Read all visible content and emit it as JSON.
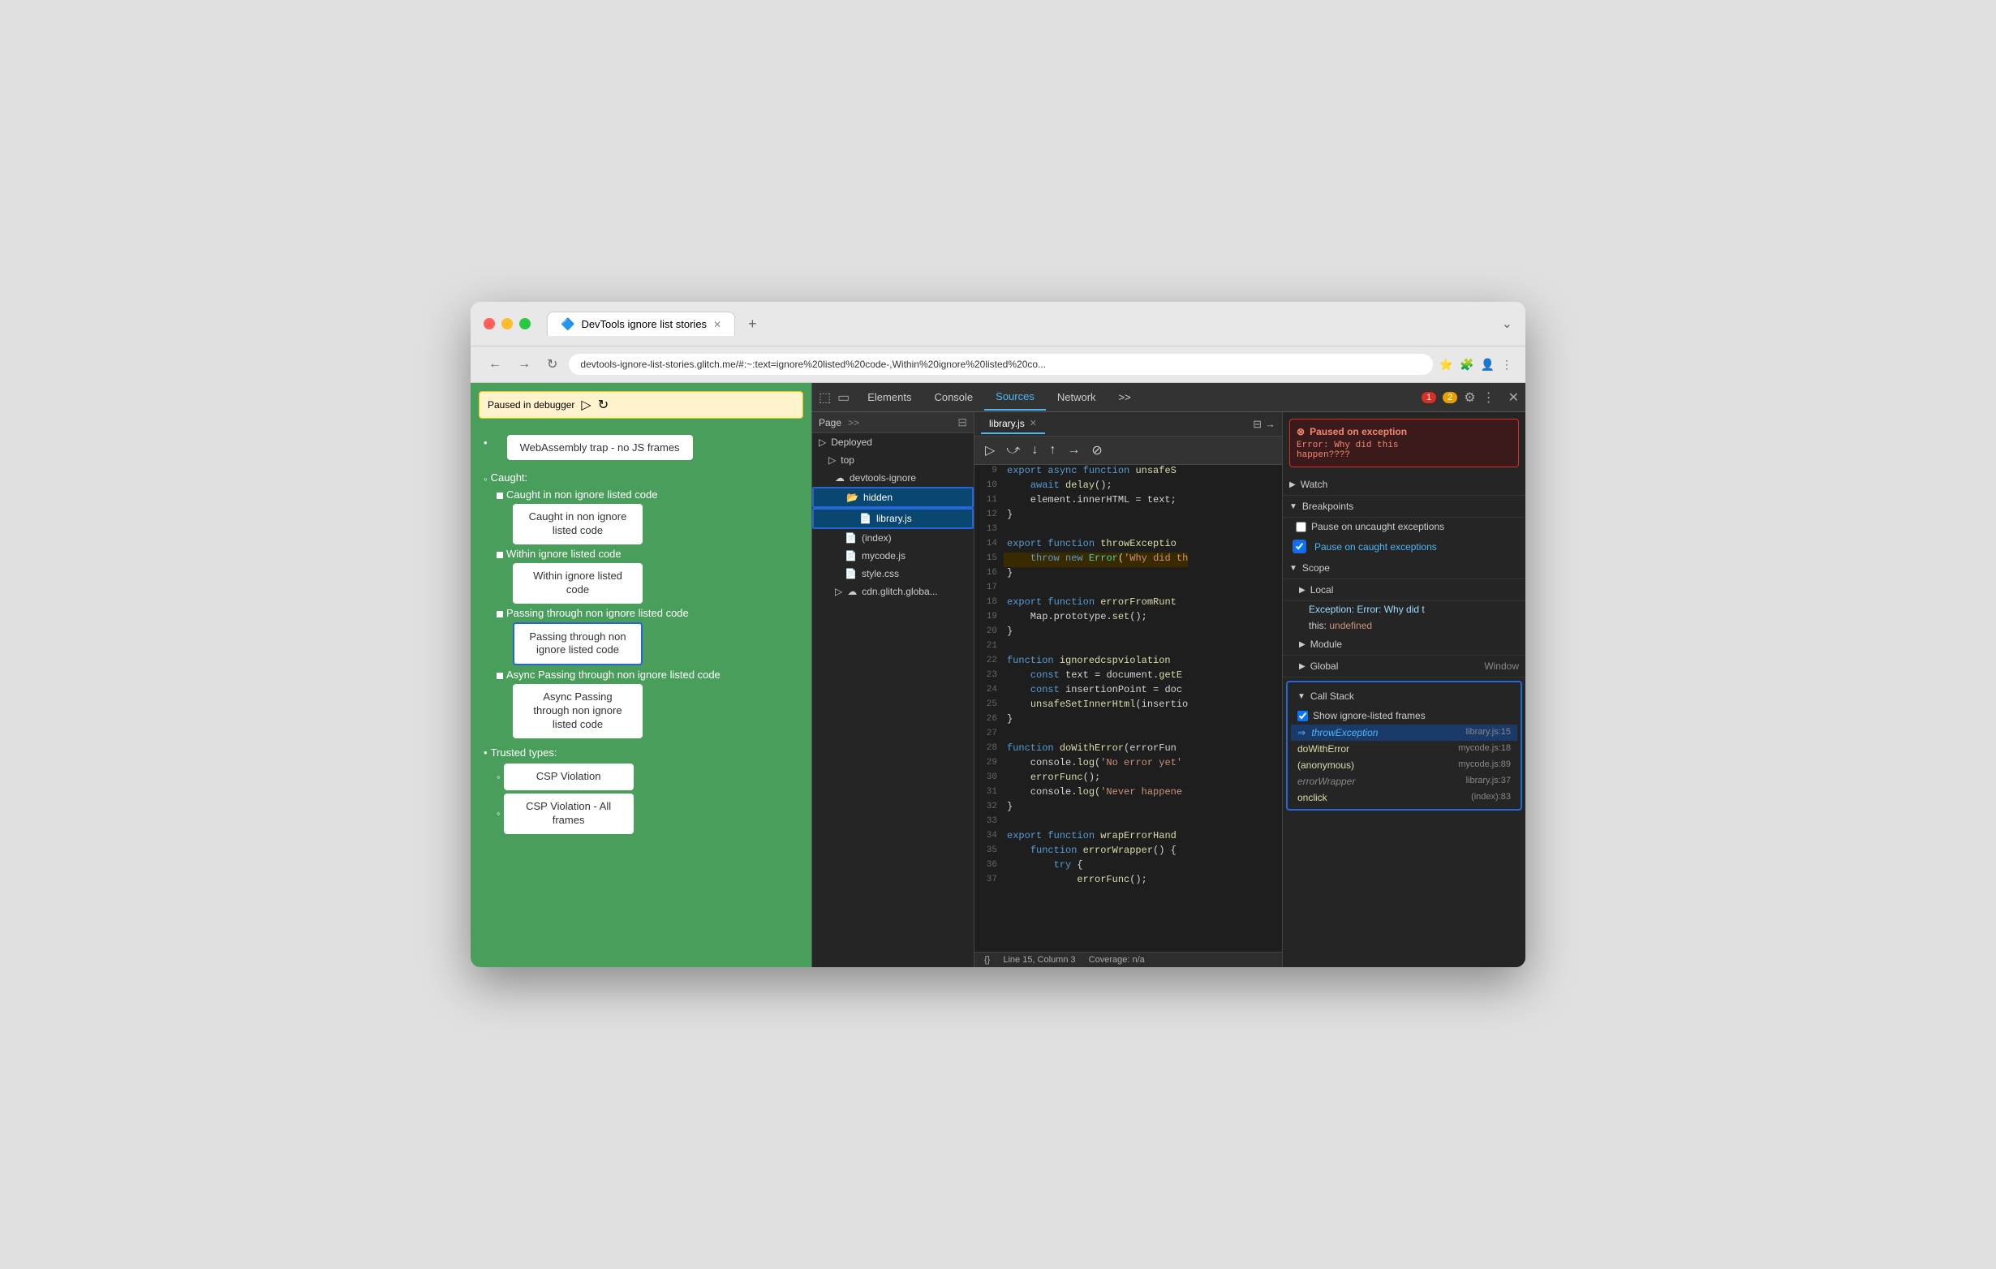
{
  "browser": {
    "tab_title": "DevTools ignore list stories",
    "tab_icon": "🔷",
    "address": "devtools-ignore-list-stories.glitch.me/#:~:text=ignore%20listed%20code-,Within%20ignore%20listed%20co...",
    "new_tab_label": "+",
    "tab_overflow_label": "⌄"
  },
  "nav": {
    "back_label": "←",
    "forward_label": "→",
    "refresh_label": "↻"
  },
  "webpage": {
    "debugger_bar": "Paused in debugger",
    "webassembly_item": "WebAssembly trap - no JS frames",
    "caught_section": "Caught:",
    "caught_items": [
      {
        "label": "Caught in non ignore listed code"
      },
      {
        "label": "Within ignore listed code"
      },
      {
        "label": "Passing through non ignore listed code"
      },
      {
        "label": "Async Passing through non ignore listed code"
      }
    ],
    "caught_btns": [
      {
        "label": "Caught in non ignore listed code",
        "active": false
      },
      {
        "label": "Within ignore listed code",
        "active": false
      },
      {
        "label": "Passing through non ignore listed code",
        "active": true
      },
      {
        "label": "Async Passing through non ignore listed code",
        "active": false
      }
    ],
    "trusted_section": "Trusted types:",
    "trusted_items": [
      {
        "label": "CSP Violation"
      },
      {
        "label": "CSP Violation - All frames"
      }
    ]
  },
  "devtools": {
    "tabs": [
      "Elements",
      "Console",
      "Sources",
      "Network",
      ">>"
    ],
    "active_tab": "Sources",
    "error_count": "1",
    "warn_count": "2",
    "file_tab_label": "library.js",
    "page_label": "Page",
    "tree": {
      "deployed_label": "Deployed",
      "top_label": "top",
      "devtools_ignore_label": "devtools-ignore",
      "hidden_label": "hidden",
      "library_label": "library.js",
      "index_label": "(index)",
      "mycode_label": "mycode.js",
      "style_label": "style.css",
      "cdn_label": "cdn.glitch.globa..."
    },
    "code_lines": [
      {
        "num": "9",
        "content": "export async function unsafeS",
        "highlight": false
      },
      {
        "num": "10",
        "content": "    await delay();",
        "highlight": false
      },
      {
        "num": "11",
        "content": "    element.innerHTML = text;",
        "highlight": false
      },
      {
        "num": "12",
        "content": "}",
        "highlight": false
      },
      {
        "num": "13",
        "content": "",
        "highlight": false
      },
      {
        "num": "14",
        "content": "export function throwExceptio",
        "highlight": false
      },
      {
        "num": "15",
        "content": "    throw new Error('Why did th",
        "highlight": true
      },
      {
        "num": "16",
        "content": "}",
        "highlight": false
      },
      {
        "num": "17",
        "content": "",
        "highlight": false
      },
      {
        "num": "18",
        "content": "export function errorFromRunt",
        "highlight": false
      },
      {
        "num": "19",
        "content": "    Map.prototype.set();",
        "highlight": false
      },
      {
        "num": "20",
        "content": "}",
        "highlight": false
      },
      {
        "num": "21",
        "content": "",
        "highlight": false
      },
      {
        "num": "22",
        "content": "function ignoredcspviolation",
        "highlight": false
      },
      {
        "num": "23",
        "content": "    const text = document.getE",
        "highlight": false
      },
      {
        "num": "24",
        "content": "    const insertionPoint = doc",
        "highlight": false
      },
      {
        "num": "25",
        "content": "    unsafeSetInnerHtml(insertio",
        "highlight": false
      },
      {
        "num": "26",
        "content": "}",
        "highlight": false
      },
      {
        "num": "27",
        "content": "",
        "highlight": false
      },
      {
        "num": "28",
        "content": "function doWithError(errorFun",
        "highlight": false
      },
      {
        "num": "29",
        "content": "    console.log('No error yet'",
        "highlight": false
      },
      {
        "num": "30",
        "content": "    errorFunc();",
        "highlight": false
      },
      {
        "num": "31",
        "content": "    console.log('Never happene",
        "highlight": false
      },
      {
        "num": "32",
        "content": "}",
        "highlight": false
      },
      {
        "num": "33",
        "content": "",
        "highlight": false
      },
      {
        "num": "34",
        "content": "export function wrapErrorHand",
        "highlight": false
      },
      {
        "num": "35",
        "content": "    function errorWrapper() {",
        "highlight": false
      },
      {
        "num": "36",
        "content": "        try {",
        "highlight": false
      },
      {
        "num": "37",
        "content": "            errorFunc();",
        "highlight": false
      }
    ],
    "status_bar": {
      "line_col": "Line 15, Column 3",
      "coverage": "Coverage: n/a"
    },
    "debugger": {
      "exception_title": "⊗ Paused on exception",
      "exception_msg": "Error: Why did this\nhappen????",
      "watch_label": "Watch",
      "breakpoints_label": "Breakpoints",
      "pause_uncaught_label": "Pause on uncaught exceptions",
      "pause_caught_label": "Pause on caught exceptions",
      "pause_caught_checked": true,
      "scope_label": "Scope",
      "local_label": "Local",
      "exception_key": "Exception: Error: Why did t",
      "this_val": "this: undefined",
      "module_label": "Module",
      "global_label": "Global",
      "global_val": "Window",
      "callstack_label": "Call Stack",
      "show_frames_label": "Show ignore-listed frames",
      "show_frames_checked": true,
      "frames": [
        {
          "name": "throwException",
          "loc": "library.js:15",
          "active": true,
          "dimmed": true
        },
        {
          "name": "doWithError",
          "loc": "mycode.js:18",
          "active": false,
          "dimmed": false
        },
        {
          "name": "(anonymous)",
          "loc": "mycode.js:89",
          "active": false,
          "dimmed": false
        },
        {
          "name": "errorWrapper",
          "loc": "library.js:37",
          "active": false,
          "dimmed": true
        },
        {
          "name": "onclick",
          "loc": "(index):83",
          "active": false,
          "dimmed": false
        }
      ]
    }
  }
}
